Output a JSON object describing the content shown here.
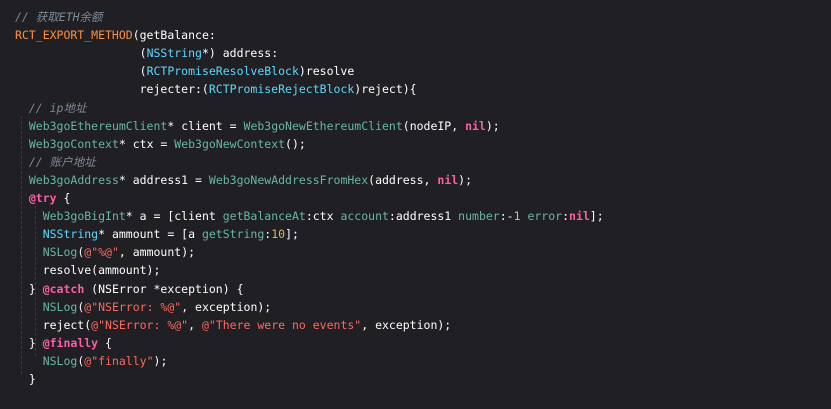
{
  "code_lines": [
    [
      {
        "c": "cm",
        "t": "// 获取ETH余额"
      }
    ],
    [
      {
        "c": "macro",
        "t": "RCT_EXPORT_METHOD"
      },
      {
        "c": "pl",
        "t": "(getBalance:"
      }
    ],
    [
      {
        "c": "pl",
        "t": "                  ("
      },
      {
        "c": "type",
        "t": "NSString"
      },
      {
        "c": "pl",
        "t": "*) address:"
      }
    ],
    [
      {
        "c": "pl",
        "t": "                  ("
      },
      {
        "c": "type",
        "t": "RCTPromiseResolveBlock"
      },
      {
        "c": "pl",
        "t": ")resolve"
      }
    ],
    [
      {
        "c": "pl",
        "t": "                  rejecter:("
      },
      {
        "c": "type",
        "t": "RCTPromiseRejectBlock"
      },
      {
        "c": "pl",
        "t": ")reject){"
      }
    ],
    [
      {
        "c": "cm",
        "t": "  // ip地址"
      }
    ],
    [
      {
        "c": "pl",
        "t": "  "
      },
      {
        "c": "fn",
        "t": "Web3goEthereumClient"
      },
      {
        "c": "pl",
        "t": "* client = "
      },
      {
        "c": "fn",
        "t": "Web3goNewEthereumClient"
      },
      {
        "c": "pl",
        "t": "(nodeIP, "
      },
      {
        "c": "kw",
        "t": "nil"
      },
      {
        "c": "pl",
        "t": ");"
      }
    ],
    [
      {
        "c": "pl",
        "t": "  "
      },
      {
        "c": "fn",
        "t": "Web3goContext"
      },
      {
        "c": "pl",
        "t": "* ctx = "
      },
      {
        "c": "fn",
        "t": "Web3goNewContext"
      },
      {
        "c": "pl",
        "t": "();"
      }
    ],
    [
      {
        "c": "cm",
        "t": "  // 账户地址"
      }
    ],
    [
      {
        "c": "pl",
        "t": "  "
      },
      {
        "c": "fn",
        "t": "Web3goAddress"
      },
      {
        "c": "pl",
        "t": "* address1 = "
      },
      {
        "c": "fn",
        "t": "Web3goNewAddressFromHex"
      },
      {
        "c": "pl",
        "t": "(address, "
      },
      {
        "c": "kw",
        "t": "nil"
      },
      {
        "c": "pl",
        "t": ");"
      }
    ],
    [
      {
        "c": "pl",
        "t": "  "
      },
      {
        "c": "kw",
        "t": "@try"
      },
      {
        "c": "pl",
        "t": " {"
      }
    ],
    [
      {
        "c": "pl",
        "t": "    "
      },
      {
        "c": "fn",
        "t": "Web3goBigInt"
      },
      {
        "c": "pl",
        "t": "* a = [client "
      },
      {
        "c": "fn",
        "t": "getBalanceAt"
      },
      {
        "c": "pl",
        "t": ":ctx "
      },
      {
        "c": "fn",
        "t": "account"
      },
      {
        "c": "pl",
        "t": ":address1 "
      },
      {
        "c": "fn",
        "t": "number"
      },
      {
        "c": "pl",
        "t": ":-"
      },
      {
        "c": "num",
        "t": "1"
      },
      {
        "c": "pl",
        "t": " "
      },
      {
        "c": "fn",
        "t": "error"
      },
      {
        "c": "pl",
        "t": ":"
      },
      {
        "c": "kw",
        "t": "nil"
      },
      {
        "c": "pl",
        "t": "];"
      }
    ],
    [
      {
        "c": "pl",
        "t": "    "
      },
      {
        "c": "type",
        "t": "NSString"
      },
      {
        "c": "pl",
        "t": "* ammount = [a "
      },
      {
        "c": "fn",
        "t": "getString"
      },
      {
        "c": "pl",
        "t": ":"
      },
      {
        "c": "num",
        "t": "10"
      },
      {
        "c": "pl",
        "t": "];"
      }
    ],
    [
      {
        "c": "pl",
        "t": "    "
      },
      {
        "c": "fn",
        "t": "NSLog"
      },
      {
        "c": "pl",
        "t": "("
      },
      {
        "c": "str",
        "t": "@\"%@\""
      },
      {
        "c": "pl",
        "t": ", ammount);"
      }
    ],
    [
      {
        "c": "pl",
        "t": "    resolve(ammount);"
      }
    ],
    [
      {
        "c": "pl",
        "t": "  } "
      },
      {
        "c": "kw",
        "t": "@catch"
      },
      {
        "c": "pl",
        "t": " (NSError *exception) {"
      }
    ],
    [
      {
        "c": "pl",
        "t": "    "
      },
      {
        "c": "fn",
        "t": "NSLog"
      },
      {
        "c": "pl",
        "t": "("
      },
      {
        "c": "str",
        "t": "@\"NSError: %@\""
      },
      {
        "c": "pl",
        "t": ", exception);"
      }
    ],
    [
      {
        "c": "pl",
        "t": "    reject("
      },
      {
        "c": "str",
        "t": "@\"NSError: %@\""
      },
      {
        "c": "pl",
        "t": ", "
      },
      {
        "c": "str",
        "t": "@\"There were no events\""
      },
      {
        "c": "pl",
        "t": ", exception);"
      }
    ],
    [
      {
        "c": "pl",
        "t": "  } "
      },
      {
        "c": "kw",
        "t": "@finally"
      },
      {
        "c": "pl",
        "t": " {"
      }
    ],
    [
      {
        "c": "pl",
        "t": "    "
      },
      {
        "c": "fn",
        "t": "NSLog"
      },
      {
        "c": "pl",
        "t": "("
      },
      {
        "c": "str",
        "t": "@\"finally\""
      },
      {
        "c": "pl",
        "t": ");"
      }
    ],
    [
      {
        "c": "pl",
        "t": "  }"
      }
    ],
    [],
    [
      {
        "c": "pl",
        "t": "}"
      }
    ]
  ],
  "colors": {
    "background": "#1f1f24",
    "comment": "#7f8c98",
    "macro": "#fd8f3f",
    "type": "#5dd8ff",
    "function": "#67b7a4",
    "keyword": "#fc5fa3",
    "string": "#fc6a5d",
    "number": "#d0bf69",
    "plain": "#ffffff"
  }
}
